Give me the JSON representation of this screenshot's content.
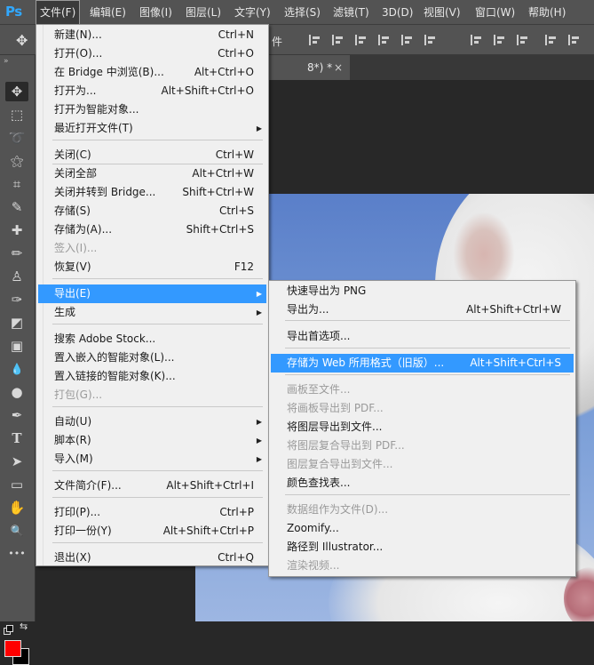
{
  "app": {
    "logo": "Ps"
  },
  "menubar": {
    "items": [
      {
        "label": "文件(F)",
        "active": true
      },
      {
        "label": "编辑(E)"
      },
      {
        "label": "图像(I)"
      },
      {
        "label": "图层(L)"
      },
      {
        "label": "文字(Y)"
      },
      {
        "label": "选择(S)"
      },
      {
        "label": "滤镜(T)"
      },
      {
        "label": "3D(D)"
      },
      {
        "label": "视图(V)"
      },
      {
        "label": "窗口(W)"
      },
      {
        "label": "帮助(H)"
      }
    ]
  },
  "options_bar": {
    "partial_text": "件"
  },
  "document_tab": {
    "title": "8*) *",
    "close_icon": "×"
  },
  "file_menu": {
    "items": [
      {
        "label": "新建(N)...",
        "shortcut": "Ctrl+N"
      },
      {
        "label": "打开(O)...",
        "shortcut": "Ctrl+O"
      },
      {
        "label": "在 Bridge 中浏览(B)...",
        "shortcut": "Alt+Ctrl+O"
      },
      {
        "label": "打开为...",
        "shortcut": "Alt+Shift+Ctrl+O"
      },
      {
        "label": "打开为智能对象..."
      },
      {
        "label": "最近打开文件(T)",
        "submenu": true
      },
      {
        "label": "关闭(C)",
        "shortcut": "Ctrl+W"
      },
      {
        "label": "关闭全部",
        "shortcut": "Alt+Ctrl+W"
      },
      {
        "label": "关闭并转到 Bridge...",
        "shortcut": "Shift+Ctrl+W"
      },
      {
        "label": "存储(S)",
        "shortcut": "Ctrl+S"
      },
      {
        "label": "存储为(A)...",
        "shortcut": "Shift+Ctrl+S"
      },
      {
        "label": "签入(I)...",
        "disabled": true
      },
      {
        "label": "恢复(V)",
        "shortcut": "F12"
      },
      {
        "label": "导出(E)",
        "submenu": true,
        "highlighted": true
      },
      {
        "label": "生成",
        "submenu": true
      },
      {
        "label": "搜索 Adobe Stock..."
      },
      {
        "label": "置入嵌入的智能对象(L)..."
      },
      {
        "label": "置入链接的智能对象(K)..."
      },
      {
        "label": "打包(G)...",
        "disabled": true
      },
      {
        "label": "自动(U)",
        "submenu": true
      },
      {
        "label": "脚本(R)",
        "submenu": true
      },
      {
        "label": "导入(M)",
        "submenu": true
      },
      {
        "label": "文件简介(F)...",
        "shortcut": "Alt+Shift+Ctrl+I"
      },
      {
        "label": "打印(P)...",
        "shortcut": "Ctrl+P"
      },
      {
        "label": "打印一份(Y)",
        "shortcut": "Alt+Shift+Ctrl+P"
      },
      {
        "label": "退出(X)",
        "shortcut": "Ctrl+Q"
      }
    ]
  },
  "export_menu": {
    "items": [
      {
        "label": "快速导出为 PNG"
      },
      {
        "label": "导出为...",
        "shortcut": "Alt+Shift+Ctrl+W"
      },
      {
        "label": "导出首选项..."
      },
      {
        "label": "存储为 Web 所用格式（旧版）...",
        "shortcut": "Alt+Shift+Ctrl+S",
        "highlighted": true
      },
      {
        "label": "画板至文件...",
        "disabled": true
      },
      {
        "label": "将画板导出到 PDF...",
        "disabled": true
      },
      {
        "label": "将图层导出到文件..."
      },
      {
        "label": "将图层复合导出到 PDF...",
        "disabled": true
      },
      {
        "label": "图层复合导出到文件...",
        "disabled": true
      },
      {
        "label": "颜色查找表..."
      },
      {
        "label": "数据组作为文件(D)...",
        "disabled": true
      },
      {
        "label": "Zoomify..."
      },
      {
        "label": "路径到 Illustrator..."
      },
      {
        "label": "渲染视频...",
        "disabled": true
      }
    ]
  },
  "toolbar": {
    "tools": [
      {
        "icon": "move-icon",
        "glyph": "✥",
        "selected": true
      },
      {
        "icon": "marquee-icon",
        "glyph": "⬚"
      },
      {
        "icon": "lasso-icon",
        "glyph": "➰"
      },
      {
        "icon": "magic-wand-icon",
        "glyph": "⚝"
      },
      {
        "icon": "crop-icon",
        "glyph": "⌗"
      },
      {
        "icon": "eyedropper-icon",
        "glyph": "✎"
      },
      {
        "icon": "healing-brush-icon",
        "glyph": "✚"
      },
      {
        "icon": "brush-icon",
        "glyph": "✏"
      },
      {
        "icon": "stamp-icon",
        "glyph": "♙"
      },
      {
        "icon": "history-brush-icon",
        "glyph": "✑"
      },
      {
        "icon": "eraser-icon",
        "glyph": "◩"
      },
      {
        "icon": "gradient-icon",
        "glyph": "▣"
      },
      {
        "icon": "blur-icon",
        "glyph": "💧"
      },
      {
        "icon": "dodge-icon",
        "glyph": "●"
      },
      {
        "icon": "pen-icon",
        "glyph": "✒"
      },
      {
        "icon": "type-icon",
        "glyph": "T"
      },
      {
        "icon": "path-selection-icon",
        "glyph": "➤"
      },
      {
        "icon": "rectangle-icon",
        "glyph": "▭"
      },
      {
        "icon": "hand-icon",
        "glyph": "✋"
      },
      {
        "icon": "zoom-icon",
        "glyph": "🔍"
      },
      {
        "icon": "more-tools-icon",
        "glyph": "•••"
      }
    ],
    "foreground_color": "#ff0000",
    "background_color": "#000000"
  },
  "colors": {
    "menu_highlight": "#3399ff",
    "ui_panel": "#535353",
    "ps_blue": "#31a8ff"
  }
}
